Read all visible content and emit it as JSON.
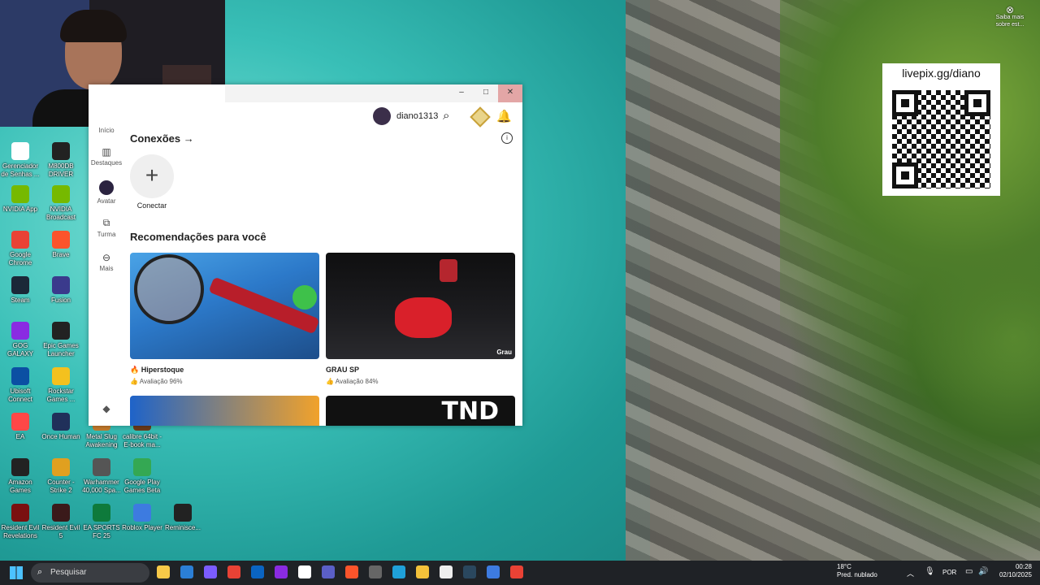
{
  "webcam": {
    "label": "streamer webcam"
  },
  "desktop_icons": [
    {
      "label": "Gerenciador de Senhas ...",
      "color": "#ffffff"
    },
    {
      "label": "M800DB DRIVER",
      "color": "#222222"
    },
    {
      "label": "NVIDIA App",
      "color": "#76b900"
    },
    {
      "label": "NVIDIA Broadcast",
      "color": "#76b900"
    },
    {
      "label": "Google Chrome",
      "color": "#e94235"
    },
    {
      "label": "Brave",
      "color": "#fb542b"
    },
    {
      "label": "Steam",
      "color": "#1b2838"
    },
    {
      "label": "Fusion",
      "color": "#3a3a8c"
    },
    {
      "label": "GOG GALAXY",
      "color": "#8a2be2"
    },
    {
      "label": "Epic Games Launcher",
      "color": "#222222"
    },
    {
      "label": "Ubisoft Connect",
      "color": "#0b4fa3"
    },
    {
      "label": "Rockstar Games ...",
      "color": "#f4c11e"
    },
    {
      "label": "EA",
      "color": "#ff4747"
    },
    {
      "label": "Once Human",
      "color": "#20305a"
    },
    {
      "label": "Metal Slug Awakening",
      "color": "#c27a2c"
    },
    {
      "label": "calibre 64bit - E-book ma...",
      "color": "#6b3a1a"
    },
    {
      "label": "Amazon Games",
      "color": "#222222"
    },
    {
      "label": "Counter -Strike 2",
      "color": "#e0a020"
    },
    {
      "label": "Warhammer 40,000 Spa...",
      "color": "#555555"
    },
    {
      "label": "Google Play Games Beta",
      "color": "#34a853"
    },
    {
      "label": "Resident Evil Revelations",
      "color": "#7a1010"
    },
    {
      "label": "Resident Evil 5",
      "color": "#3a1a1a"
    },
    {
      "label": "EA SPORTS FC 25",
      "color": "#0e7a3b"
    },
    {
      "label": "Roblox Player",
      "color": "#3d7be0"
    },
    {
      "label": "Reminisce...",
      "color": "#222222"
    }
  ],
  "window": {
    "title_controls": {
      "minimize": "–",
      "maximize": "□",
      "close": "✕"
    },
    "sidebar": [
      {
        "label": "Início",
        "icon": "home-icon"
      },
      {
        "label": "Destaques",
        "icon": "chart-icon"
      },
      {
        "label": "Avatar",
        "icon": "avatar-icon"
      },
      {
        "label": "Turma",
        "icon": "group-icon"
      },
      {
        "label": "Mais",
        "icon": "more-icon"
      }
    ],
    "username": "diano1313",
    "connections": {
      "title": "Conexões",
      "arrow": "→",
      "add_label": "Conectar",
      "add_glyph": "+"
    },
    "recommendations": {
      "title": "Recomendações para você",
      "games": [
        {
          "title": "Hiperstoque",
          "rating": "Avaliação 96%"
        },
        {
          "title": "GRAU SP",
          "rating": "Avaliação 84%",
          "tag": "Grau"
        },
        {
          "title": "",
          "rating": ""
        },
        {
          "title": "",
          "rating": "",
          "tag": "TND"
        }
      ]
    }
  },
  "qr": {
    "url": "livepix.gg/diano"
  },
  "notice": {
    "text": "Saiba mais sobre est..."
  },
  "taskbar": {
    "search_placeholder": "Pesquisar",
    "weather_temp": "18°C",
    "weather_desc": "Pred. nublado",
    "language": "POR",
    "time": "00:28",
    "date": "02/10/2025",
    "apps": [
      {
        "name": "file-explorer-icon",
        "color": "#f7c948"
      },
      {
        "name": "store-icon",
        "color": "#2b7fd6"
      },
      {
        "name": "copilot-icon",
        "color": "#7b5cff"
      },
      {
        "name": "chrome-icon",
        "color": "#e94235"
      },
      {
        "name": "outlook-icon",
        "color": "#0a64c2"
      },
      {
        "name": "circle-app-icon",
        "color": "#8a2be2"
      },
      {
        "name": "document-icon",
        "color": "#ffffff"
      },
      {
        "name": "teams-icon",
        "color": "#5b5fc7"
      },
      {
        "name": "brave-icon",
        "color": "#fb542b"
      },
      {
        "name": "calculator-icon",
        "color": "#666666"
      },
      {
        "name": "edge-icon",
        "color": "#1fa1d9"
      },
      {
        "name": "folder-icon",
        "color": "#f3c13a"
      },
      {
        "name": "github-icon",
        "color": "#eeeeee"
      },
      {
        "name": "steam-icon",
        "color": "#2a475e"
      },
      {
        "name": "roblox-studio-icon",
        "color": "#3d7be0"
      },
      {
        "name": "chrome-beta-icon",
        "color": "#e94235"
      }
    ]
  }
}
